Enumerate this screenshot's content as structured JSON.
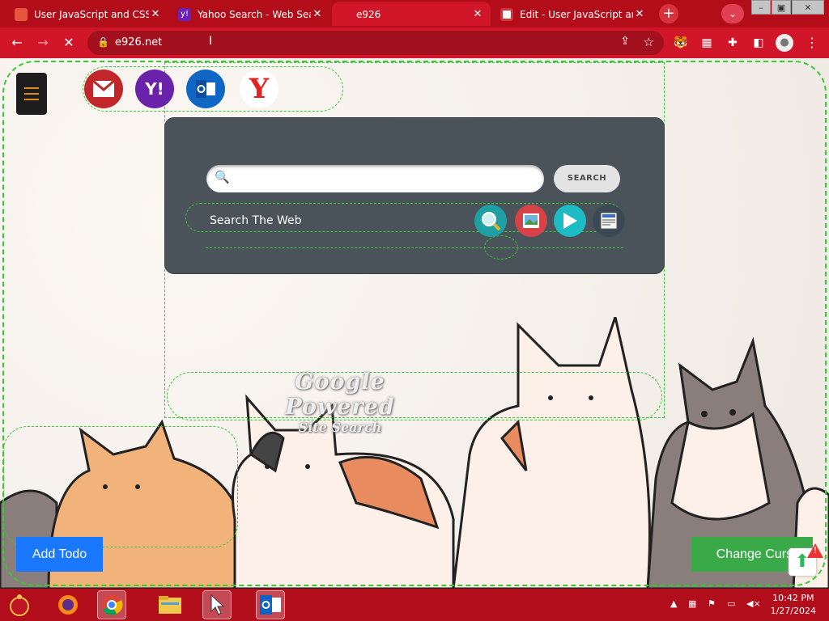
{
  "tabs": [
    {
      "title": "User JavaScript and CSS",
      "close": "✕"
    },
    {
      "title": "Yahoo Search - Web Search",
      "close": "✕"
    },
    {
      "title": "e926",
      "close": "✕"
    },
    {
      "title": "Edit - User JavaScript and CSS",
      "close": "✕"
    }
  ],
  "browser": {
    "url": "e926.net",
    "new_tab": "+"
  },
  "page": {
    "search_button": "SEARCH",
    "search_web_label": "Search The Web",
    "google_powered": "Google Powered",
    "site_search": "Site Search",
    "add_todo": "Add Todo",
    "change_cursor": "Change Cursor"
  },
  "quick_links": [
    "Gmail",
    "Yahoo",
    "Outlook",
    "Yandex"
  ],
  "taskbar": {
    "time": "10:42 PM",
    "date": "1/27/2024"
  },
  "colors": {
    "accent": "#d01628",
    "panel": "#4a525a",
    "add_todo": "#1a78ff",
    "change_cursor": "#3aaa48"
  }
}
